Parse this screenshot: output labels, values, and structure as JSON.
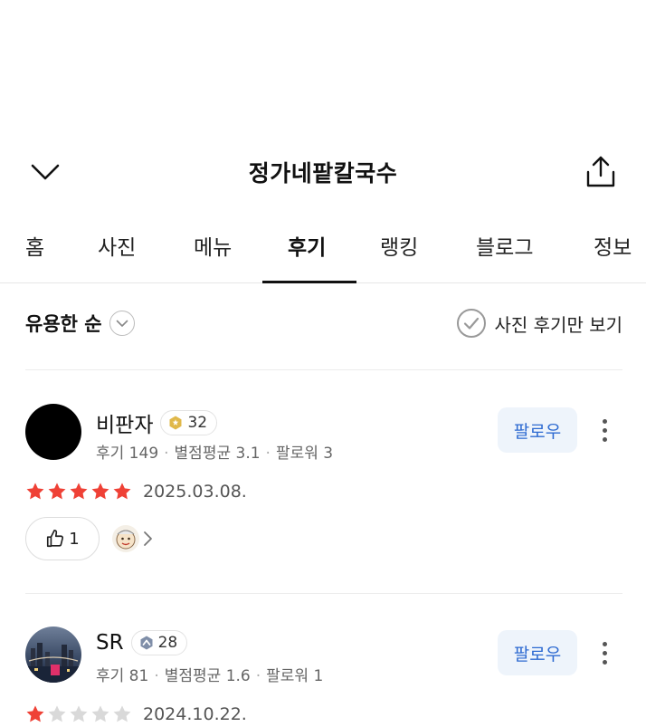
{
  "header": {
    "title": "정가네팥칼국수",
    "back_icon": "chevron-down-icon",
    "share_icon": "share-icon"
  },
  "tabs": [
    {
      "label": "홈",
      "active": false
    },
    {
      "label": "사진",
      "active": false
    },
    {
      "label": "메뉴",
      "active": false
    },
    {
      "label": "후기",
      "active": true
    },
    {
      "label": "랭킹",
      "active": false
    },
    {
      "label": "블로그",
      "active": false
    },
    {
      "label": "정보",
      "active": false
    }
  ],
  "filters": {
    "sort_label": "유용한 순",
    "photo_only_label": "사진 후기만 보기"
  },
  "reviews": [
    {
      "name": "비판자",
      "level": "32",
      "stats": {
        "reviews": "후기 149",
        "avg": "별점평균 3.1",
        "followers": "팔로워 3"
      },
      "follow_label": "팔로우",
      "rating": 5,
      "date": "2025.03.08.",
      "likes": "1"
    },
    {
      "name": "SR",
      "level": "28",
      "stats": {
        "reviews": "후기 81",
        "avg": "별점평균 1.6",
        "followers": "팔로워 1"
      },
      "follow_label": "팔로우",
      "rating": 1,
      "date": "2024.10.22."
    }
  ],
  "colors": {
    "star_on": "#ef4136",
    "star_off": "#d9d9d9",
    "follow_text": "#2d6ad1",
    "follow_bg": "#eef4fb",
    "badge_gold": "#e0b84a",
    "badge_blue": "#7f8ea8"
  }
}
